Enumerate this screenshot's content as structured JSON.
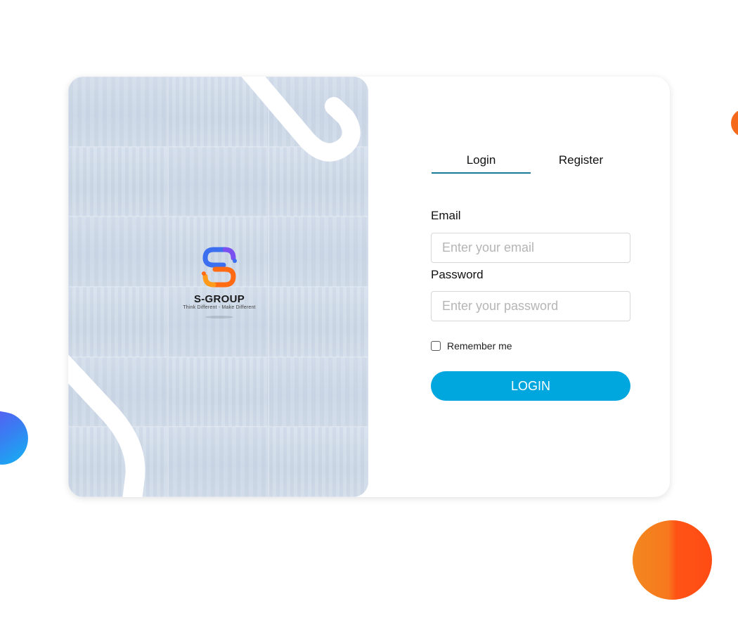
{
  "brand": {
    "name": "S-GROUP",
    "slogan": "Think Different - Make Different"
  },
  "tabs": [
    {
      "label": "Login",
      "active": true
    },
    {
      "label": "Register",
      "active": false
    }
  ],
  "form": {
    "email_label": "Email",
    "email_placeholder": "Enter your email",
    "email_value": "",
    "password_label": "Password",
    "password_placeholder": "Enter your password",
    "password_value": "",
    "remember_label": "Remember me",
    "remember_checked": false,
    "submit_label": "LOGIN"
  },
  "colors": {
    "accent": "#00a6de",
    "tab_underline": "#1b7a98",
    "blob_orange": "#f46a1a",
    "blob_blue": "#3b7bf2"
  },
  "icons": [
    "s-group-logo-icon"
  ]
}
